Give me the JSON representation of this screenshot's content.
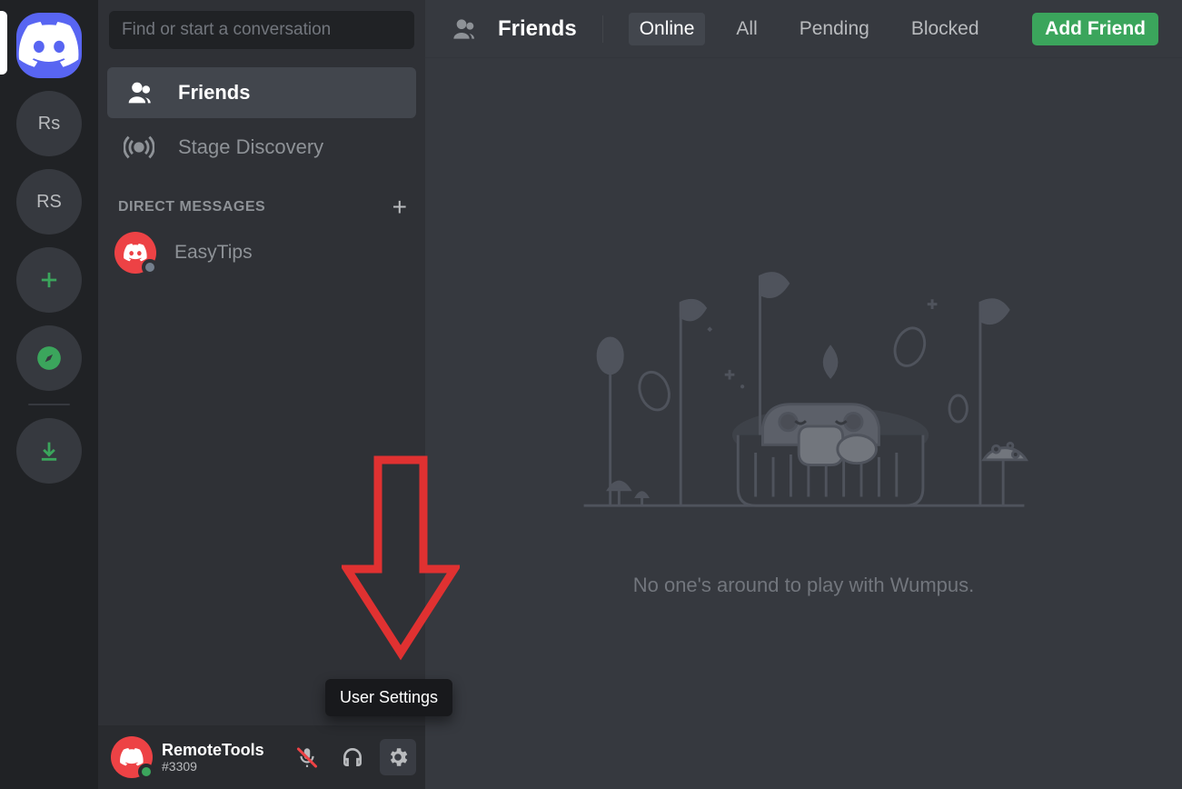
{
  "servers": [
    {
      "id": "rs1",
      "label": "Rs"
    },
    {
      "id": "rs2",
      "label": "RS"
    }
  ],
  "search": {
    "placeholder": "Find or start a conversation"
  },
  "nav": {
    "friends": {
      "label": "Friends"
    },
    "stage": {
      "label": "Stage Discovery"
    }
  },
  "dm_header": "DIRECT MESSAGES",
  "dms": [
    {
      "name": "EasyTips"
    }
  ],
  "user_panel": {
    "username": "RemoteTools",
    "tag": "#3309"
  },
  "tooltip": "User Settings",
  "header": {
    "title": "Friends",
    "tabs": {
      "online": "Online",
      "all": "All",
      "pending": "Pending",
      "blocked": "Blocked"
    },
    "add_friend": "Add Friend"
  },
  "empty_state": "No one's around to play with Wumpus.",
  "colors": {
    "blurple": "#5865f2",
    "green": "#3ba55c",
    "red": "#ed4245",
    "bg_dark": "#202225",
    "bg_sidebar": "#2f3136",
    "bg_main": "#36393f"
  }
}
